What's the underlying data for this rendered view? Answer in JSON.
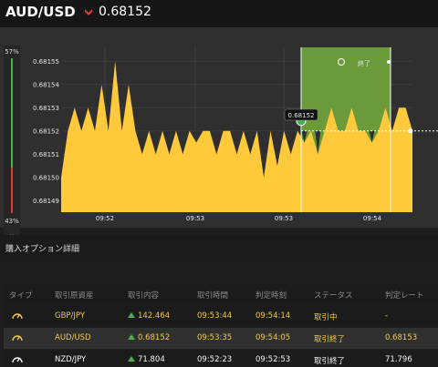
{
  "header": {
    "pair": "AUD/USD",
    "direction_icon": "down-chevron-icon",
    "price": "0.68152",
    "down_color": "#e53935"
  },
  "gauge": {
    "top_pct": "57%",
    "bottom_pct": "43%",
    "close_label": "×"
  },
  "chart_data": {
    "type": "area",
    "y_ticks": [
      "0.68155",
      "0.68154",
      "0.68153",
      "0.68152",
      "0.68151",
      "0.68150",
      "0.68149"
    ],
    "x_ticks": [
      "09:52",
      "09:53",
      "09:53",
      "09:54"
    ],
    "strike_label": "0.68152",
    "end_label": "終了",
    "end_icon": "clock-icon",
    "fill_color": "#ffc93c",
    "expired_zone_color": "#6a9a3a",
    "series": [
      {
        "values": [
          0.6815,
          0.68152,
          0.68153,
          0.68152,
          0.68153,
          0.68152,
          0.68154,
          0.68152,
          0.68155,
          0.68152,
          0.68154,
          0.68152,
          0.68151,
          0.68152,
          0.68151,
          0.68152,
          0.68151,
          0.68152,
          0.68151,
          0.68152,
          0.681515,
          0.68152,
          0.68152,
          0.68151,
          0.68152,
          0.68152,
          0.68151,
          0.68152,
          0.68151,
          0.68152,
          0.6815,
          0.68152,
          0.681505,
          0.68152,
          0.68151,
          0.68152,
          0.681515,
          0.68152,
          0.68151,
          0.68152,
          0.68153,
          0.68152,
          0.68152,
          0.68153,
          0.68152,
          0.68152,
          0.681515,
          0.68152,
          0.68153,
          0.68152,
          0.68153,
          0.68153,
          0.68152
        ]
      }
    ]
  },
  "section": {
    "title": "購入オプション詳細"
  },
  "table": {
    "headers": [
      "タイプ",
      "取引原資産",
      "取引内容",
      "取引時間",
      "判定時刻",
      "ステータス",
      "判定レート"
    ],
    "rows": [
      {
        "type_icon": "speedometer-icon",
        "asset": "GBP/JPY",
        "trade_icon": "up-arrow-icon",
        "value": "142.464",
        "time": "09:53:44",
        "judge": "09:54:14",
        "status": "取引中",
        "rate": "-"
      },
      {
        "type_icon": "speedometer-icon",
        "asset": "AUD/USD",
        "trade_icon": "up-arrow-icon",
        "value": "0.68152",
        "time": "09:53:35",
        "judge": "09:54:05",
        "status": "取引終了",
        "rate": "0.68153"
      },
      {
        "type_icon": "speedometer-icon",
        "asset": "NZD/JPY",
        "trade_icon": "up-arrow-icon",
        "value": "71.804",
        "time": "09:52:23",
        "judge": "09:52:53",
        "status": "取引終了",
        "rate": "71.796"
      }
    ]
  }
}
